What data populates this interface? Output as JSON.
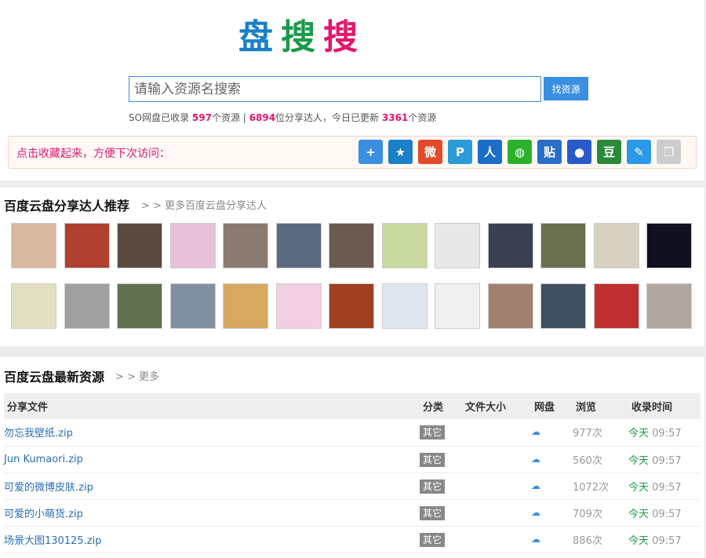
{
  "logo": {
    "c1": "盘",
    "c2": "搜",
    "c3": "搜"
  },
  "search": {
    "placeholder": "请输入资源名搜索",
    "button": "找资源"
  },
  "stats": {
    "p1": "SO网盘已收录 ",
    "n1": "597",
    "p2": "个资源 | ",
    "n2": "6894",
    "p3": "位分享达人，今日已更新 ",
    "n3": "3361",
    "p4": "个资源"
  },
  "share": {
    "text": "点击收藏起来，方便下次访问：",
    "icons": [
      {
        "name": "add-icon",
        "glyph": "+",
        "color": "#3b8fe0"
      },
      {
        "name": "favorite-star-icon",
        "glyph": "★",
        "color": "#1a80c8"
      },
      {
        "name": "weibo-icon",
        "glyph": "微",
        "color": "#e24a2a"
      },
      {
        "name": "tencent-weibo-icon",
        "glyph": "P",
        "color": "#2a9ad8"
      },
      {
        "name": "renren-icon",
        "glyph": "人",
        "color": "#1a6ec8"
      },
      {
        "name": "wechat-icon",
        "glyph": "◍",
        "color": "#2ab22a"
      },
      {
        "name": "tieba-icon",
        "glyph": "贴",
        "color": "#2a6ec8"
      },
      {
        "name": "baidu-paw-icon",
        "glyph": "●",
        "color": "#2a5ac8"
      },
      {
        "name": "douban-icon",
        "glyph": "豆",
        "color": "#2a8a3a"
      },
      {
        "name": "edit-share-icon",
        "glyph": "✎",
        "color": "#2a9ae8"
      },
      {
        "name": "copy-icon",
        "glyph": "❐",
        "color": "#cccccc"
      }
    ]
  },
  "experts": {
    "title": "百度云盘分享达人推荐",
    "more": "> > 更多百度云盘分享达人",
    "avatar_colors": [
      "#d9b8a0",
      "#b04030",
      "#5a4a40",
      "#e8c0d8",
      "#8a7a70",
      "#5a6a80",
      "#6a5a50",
      "#c8d8a0",
      "#e8e8e8",
      "#3a4050",
      "#6a7050",
      "#d8d0c0",
      "#101020",
      "#e0e0c0",
      "#a0a0a0",
      "#607050",
      "#8090a0",
      "#d8a860",
      "#f0d0e0",
      "#a04020",
      "#dfe6ee",
      "#f0f0f0",
      "#a08070",
      "#405060",
      "#c03030",
      "#b0a8a0"
    ]
  },
  "latest": {
    "title": "百度云盘最新资源",
    "more": "> > 更多",
    "headers": [
      "分享文件",
      "分类",
      "文件大小",
      "网盘",
      "浏览",
      "收录时间"
    ],
    "rows": [
      {
        "file": "勿忘我壁纸.zip",
        "cat": "其它",
        "size": "",
        "pan": "☁",
        "views": "977次",
        "today": "今天",
        "time": "09:57"
      },
      {
        "file": "Jun Kumaori.zip",
        "cat": "其它",
        "size": "",
        "pan": "☁",
        "views": "560次",
        "today": "今天",
        "time": "09:57"
      },
      {
        "file": "可爱的微博皮肤.zip",
        "cat": "其它",
        "size": "",
        "pan": "☁",
        "views": "1072次",
        "today": "今天",
        "time": "09:57"
      },
      {
        "file": "可爱的小萌货.zip",
        "cat": "其它",
        "size": "",
        "pan": "☁",
        "views": "709次",
        "today": "今天",
        "time": "09:57"
      },
      {
        "file": "场景大图130125.zip",
        "cat": "其它",
        "size": "",
        "pan": "☁",
        "views": "886次",
        "today": "今天",
        "time": "09:57"
      }
    ]
  }
}
